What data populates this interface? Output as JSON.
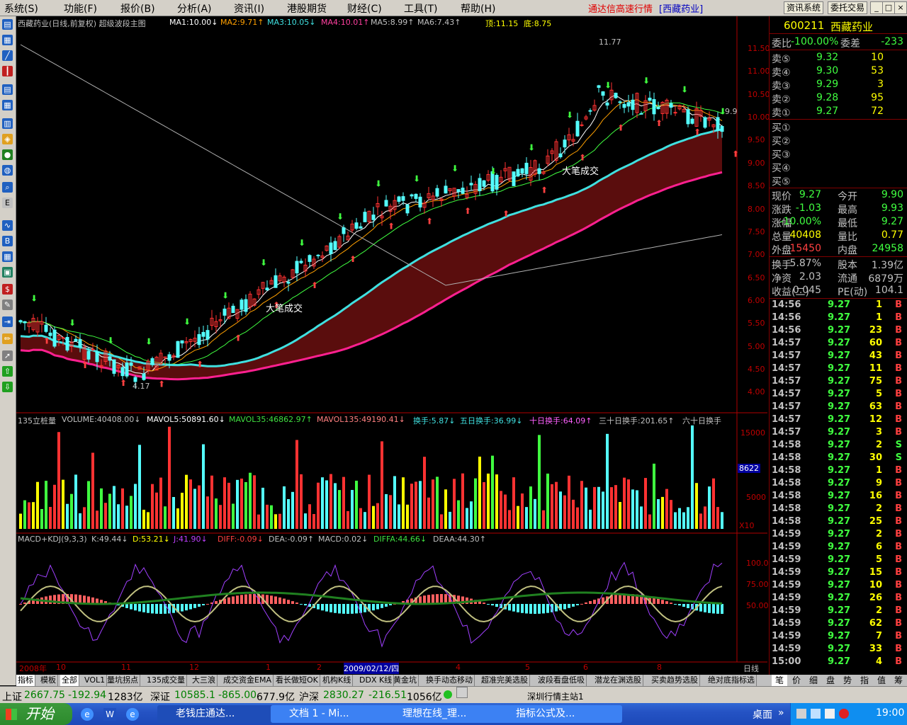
{
  "menu": {
    "items": [
      "系统(S)",
      "功能(F)",
      "报价(B)",
      "分析(A)",
      "资讯(I)",
      "港股期货",
      "财经(C)",
      "工具(T)",
      "帮助(H)"
    ],
    "title_main": "通达信高速行情",
    "title_stock": "[西藏药业]",
    "btn_info": "资讯系统",
    "btn_trade": "委托交易"
  },
  "chart": {
    "header": {
      "name": "西藏药业(日线,前复权) 超级波段主图",
      "ma1": "MA1:10.00↓",
      "ma2": "MA2:9.71↑",
      "ma3": "MA3:10.05↓",
      "ma4": "MA4:10.01↑",
      "ma5": "MA5:8.99↑",
      "ma6": "MA6:7.43↑",
      "top": "顶:11.15",
      "bottom": "底:8.75"
    },
    "price_axis": [
      "11.50",
      "11.00",
      "10.50",
      "10.00",
      "9.50",
      "9.00",
      "8.50",
      "8.00",
      "7.50",
      "7.00",
      "6.50",
      "6.00",
      "5.50",
      "5.00",
      "4.50",
      "4.00"
    ],
    "annotations": {
      "high": "11.77",
      "low": "4.17",
      "last": "9.9",
      "big_deal_1": "大笔成交",
      "big_deal_2": "大笔成交"
    },
    "volume": {
      "label": "135立桩量",
      "vol": "VOLUME:40408.00↓",
      "mavol5": "MAVOL5:50891.60↓",
      "mavol35": "MAVOL35:46862.97↑",
      "mavol135": "MAVOL135:49190.41↓",
      "hs1": "换手:5.87↓",
      "hs5": "五日换手:36.99↓",
      "hs10": "十日换手:64.09↑",
      "hs30": "三十日换手:201.65↑",
      "hs60": "六十日换手",
      "axis_top": "15000",
      "axis_mid": "5000",
      "current": "8622",
      "unit": "X10"
    },
    "macd": {
      "label": "MACD+KDJ(9,3,3)",
      "k": "K:49.44↓",
      "d": "D:53.21↓",
      "j": "J:41.90↓",
      "diff": "DIFF:-0.09↓",
      "dea": "DEA:-0.09↑",
      "macd": "MACD:0.02↓",
      "diffa": "DIFFA:44.66↓",
      "deaa": "DEAA:44.30↑",
      "axis": [
        "100.0",
        "75.00",
        "50.00"
      ]
    },
    "date_axis": [
      "2008年",
      "10",
      "11",
      "12",
      "1",
      "2",
      "2009/02/12/四",
      "4",
      "5",
      "6",
      "8"
    ],
    "period_label": "日线"
  },
  "quote": {
    "code": "600211",
    "name": "西藏药业",
    "ratio_label": "委比",
    "ratio": "-100.00%",
    "diff_label": "委差",
    "diff": "-233",
    "asks": [
      {
        "label": "卖⑤",
        "price": "9.32",
        "vol": "10"
      },
      {
        "label": "卖④",
        "price": "9.30",
        "vol": "53"
      },
      {
        "label": "卖③",
        "price": "9.29",
        "vol": "3"
      },
      {
        "label": "卖②",
        "price": "9.28",
        "vol": "95"
      },
      {
        "label": "卖①",
        "price": "9.27",
        "vol": "72"
      }
    ],
    "bids": [
      {
        "label": "买①"
      },
      {
        "label": "买②"
      },
      {
        "label": "买③"
      },
      {
        "label": "买④"
      },
      {
        "label": "买⑤"
      }
    ],
    "stats": [
      {
        "l1": "现价",
        "v1": "9.27",
        "l2": "今开",
        "v2": "9.90"
      },
      {
        "l1": "涨跌",
        "v1": "-1.03",
        "l2": "最高",
        "v2": "9.93"
      },
      {
        "l1": "涨幅",
        "v1": "-10.00%",
        "l2": "最低",
        "v2": "9.27"
      },
      {
        "l1": "总量",
        "v1": "40408",
        "l2": "量比",
        "v2": "0.77"
      },
      {
        "l1": "外盘",
        "v1": "15450",
        "l2": "内盘",
        "v2": "24958"
      }
    ],
    "stats2": [
      {
        "l1": "换手",
        "v1": "5.87%",
        "l2": "股本",
        "v2": "1.39亿"
      },
      {
        "l1": "净资",
        "v1": "2.03",
        "l2": "流通",
        "v2": "6879万"
      },
      {
        "l1": "收益(二)",
        "v1": "0.045",
        "l2": "PE(动)",
        "v2": "104.1"
      }
    ],
    "ticks": [
      {
        "t": "14:56",
        "p": "9.27",
        "v": "1",
        "s": "B"
      },
      {
        "t": "14:56",
        "p": "9.27",
        "v": "1",
        "s": "B"
      },
      {
        "t": "14:56",
        "p": "9.27",
        "v": "23",
        "s": "B"
      },
      {
        "t": "14:57",
        "p": "9.27",
        "v": "60",
        "s": "B"
      },
      {
        "t": "14:57",
        "p": "9.27",
        "v": "43",
        "s": "B"
      },
      {
        "t": "14:57",
        "p": "9.27",
        "v": "11",
        "s": "B"
      },
      {
        "t": "14:57",
        "p": "9.27",
        "v": "75",
        "s": "B"
      },
      {
        "t": "14:57",
        "p": "9.27",
        "v": "5",
        "s": "B"
      },
      {
        "t": "14:57",
        "p": "9.27",
        "v": "63",
        "s": "B"
      },
      {
        "t": "14:57",
        "p": "9.27",
        "v": "12",
        "s": "B"
      },
      {
        "t": "14:57",
        "p": "9.27",
        "v": "3",
        "s": "B"
      },
      {
        "t": "14:58",
        "p": "9.27",
        "v": "2",
        "s": "S"
      },
      {
        "t": "14:58",
        "p": "9.27",
        "v": "30",
        "s": "S"
      },
      {
        "t": "14:58",
        "p": "9.27",
        "v": "1",
        "s": "B"
      },
      {
        "t": "14:58",
        "p": "9.27",
        "v": "9",
        "s": "B"
      },
      {
        "t": "14:58",
        "p": "9.27",
        "v": "16",
        "s": "B"
      },
      {
        "t": "14:58",
        "p": "9.27",
        "v": "2",
        "s": "B"
      },
      {
        "t": "14:58",
        "p": "9.27",
        "v": "25",
        "s": "B"
      },
      {
        "t": "14:59",
        "p": "9.27",
        "v": "2",
        "s": "B"
      },
      {
        "t": "14:59",
        "p": "9.27",
        "v": "6",
        "s": "B"
      },
      {
        "t": "14:59",
        "p": "9.27",
        "v": "5",
        "s": "B"
      },
      {
        "t": "14:59",
        "p": "9.27",
        "v": "15",
        "s": "B"
      },
      {
        "t": "14:59",
        "p": "9.27",
        "v": "10",
        "s": "B"
      },
      {
        "t": "14:59",
        "p": "9.27",
        "v": "26",
        "s": "B"
      },
      {
        "t": "14:59",
        "p": "9.27",
        "v": "2",
        "s": "B"
      },
      {
        "t": "14:59",
        "p": "9.27",
        "v": "62",
        "s": "B"
      },
      {
        "t": "14:59",
        "p": "9.27",
        "v": "7",
        "s": "B"
      },
      {
        "t": "14:59",
        "p": "9.27",
        "v": "33",
        "s": "B"
      },
      {
        "t": "15:00",
        "p": "9.27",
        "v": "4",
        "s": "B"
      }
    ]
  },
  "bottom_tabs": [
    "指标",
    "模板",
    "全部",
    "VOL1",
    "量坑拐点",
    "135成交量",
    "大三浪",
    "成交资金EMA",
    "看长做短OK",
    "机构K线",
    "DDX K线",
    "黄金坑",
    "换手动态移动",
    "超准完美选股",
    "波段看盘低吸",
    "潜龙在渊选股",
    "买卖趋势选股",
    "绝对底指标选"
  ],
  "right_tabs": [
    "笔",
    "价",
    "细",
    "盘",
    "势",
    "指",
    "值",
    "筹"
  ],
  "status": {
    "sh_label": "上证",
    "sh_idx": "2667.75",
    "sh_chg": "-192.94",
    "sh_amt": "1283亿",
    "sz_label": "深证",
    "sz_idx": "10585.1",
    "sz_chg": "-865.00",
    "sz_amt": "677.9亿",
    "hs_label": "沪深",
    "hs_idx": "2830.27",
    "hs_chg": "-216.51",
    "hs_amt": "1056亿",
    "server": "深圳行情主站1"
  },
  "taskbar": {
    "start": "开始",
    "tasks": [
      "老钱庄通达...",
      "文档 1 - Mi...",
      "理想在线_理...",
      "指标公式及..."
    ],
    "desktop": "桌面",
    "time": "19:00"
  }
}
